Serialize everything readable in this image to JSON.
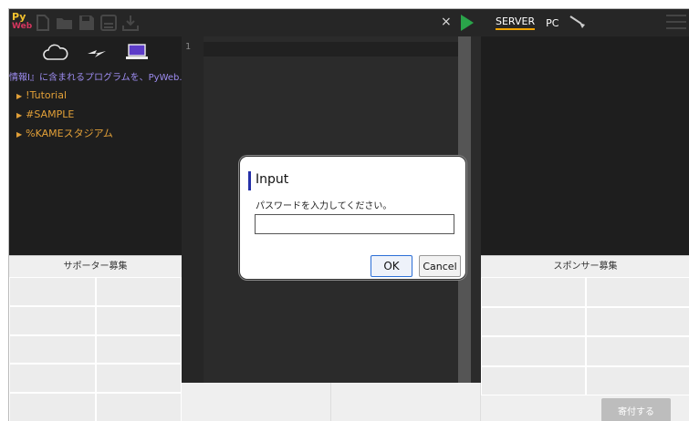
{
  "toolbar": {
    "logo_top": "Py",
    "logo_bottom": "Web",
    "icons": [
      "new-file-icon",
      "open-folder-icon",
      "save-icon",
      "save-as-icon",
      "download-icon"
    ]
  },
  "storage": {
    "icons": [
      "cloud-icon",
      "connect-icon",
      "laptop-icon"
    ]
  },
  "sidebar": {
    "hint": "情報Ⅰ』に含まれるプログラムを、PyWeb.",
    "items": [
      {
        "label": "!Tutorial"
      },
      {
        "label": "#SAMPLE"
      },
      {
        "label": "%KAMEスタジアム"
      }
    ],
    "supporter_header": "サポーター募集"
  },
  "editor": {
    "close_label": "×",
    "line_number": "1"
  },
  "right_panel": {
    "tabs": [
      {
        "label": "SERVER",
        "active": true
      },
      {
        "label": "PC",
        "active": false
      }
    ],
    "sponsor_header": "スポンサー募集",
    "donate_label": "寄付する"
  },
  "dialog": {
    "title": "Input",
    "message": "パスワードを入力してください。",
    "input_value": "",
    "ok_label": "OK",
    "cancel_label": "Cancel"
  },
  "colors": {
    "accent_tab": "#f2a400",
    "run_button": "#2aa44a",
    "tree_item": "#e2a038",
    "hint_text": "#9d8cf0",
    "dialog_bar": "#2530a8"
  }
}
